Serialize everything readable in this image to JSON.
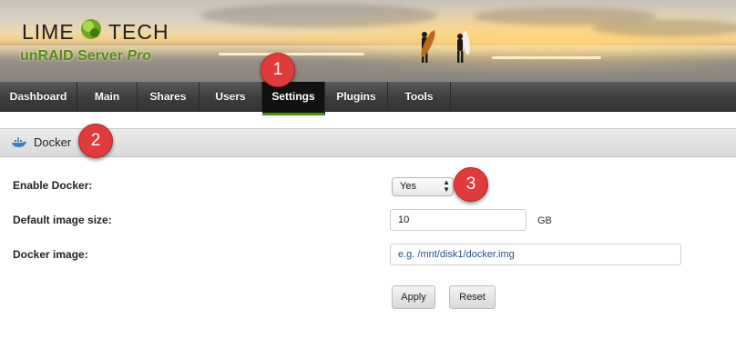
{
  "logo": {
    "brand_left": "LIME",
    "brand_right": "TECH",
    "product": "unRAID Server",
    "edition": "Pro"
  },
  "nav": [
    {
      "label": "Dashboard",
      "active": false
    },
    {
      "label": "Main",
      "active": false
    },
    {
      "label": "Shares",
      "active": false
    },
    {
      "label": "Users",
      "active": false
    },
    {
      "label": "Settings",
      "active": true
    },
    {
      "label": "Plugins",
      "active": false
    },
    {
      "label": "Tools",
      "active": false
    }
  ],
  "section": {
    "title": "Docker",
    "icon": "docker-whale-icon"
  },
  "form": {
    "enable_docker": {
      "label": "Enable Docker:",
      "value": "Yes"
    },
    "image_size": {
      "label": "Default image size:",
      "value": "10",
      "unit": "GB"
    },
    "docker_image": {
      "label": "Docker image:",
      "placeholder": "e.g. /mnt/disk1/docker.img"
    }
  },
  "buttons": {
    "apply": "Apply",
    "reset": "Reset"
  },
  "markers": [
    "1",
    "2",
    "3"
  ],
  "colors": {
    "accent_green": "#4c8e0f",
    "marker_red": "#e23b3b",
    "product_green": "#5a8a0f"
  }
}
